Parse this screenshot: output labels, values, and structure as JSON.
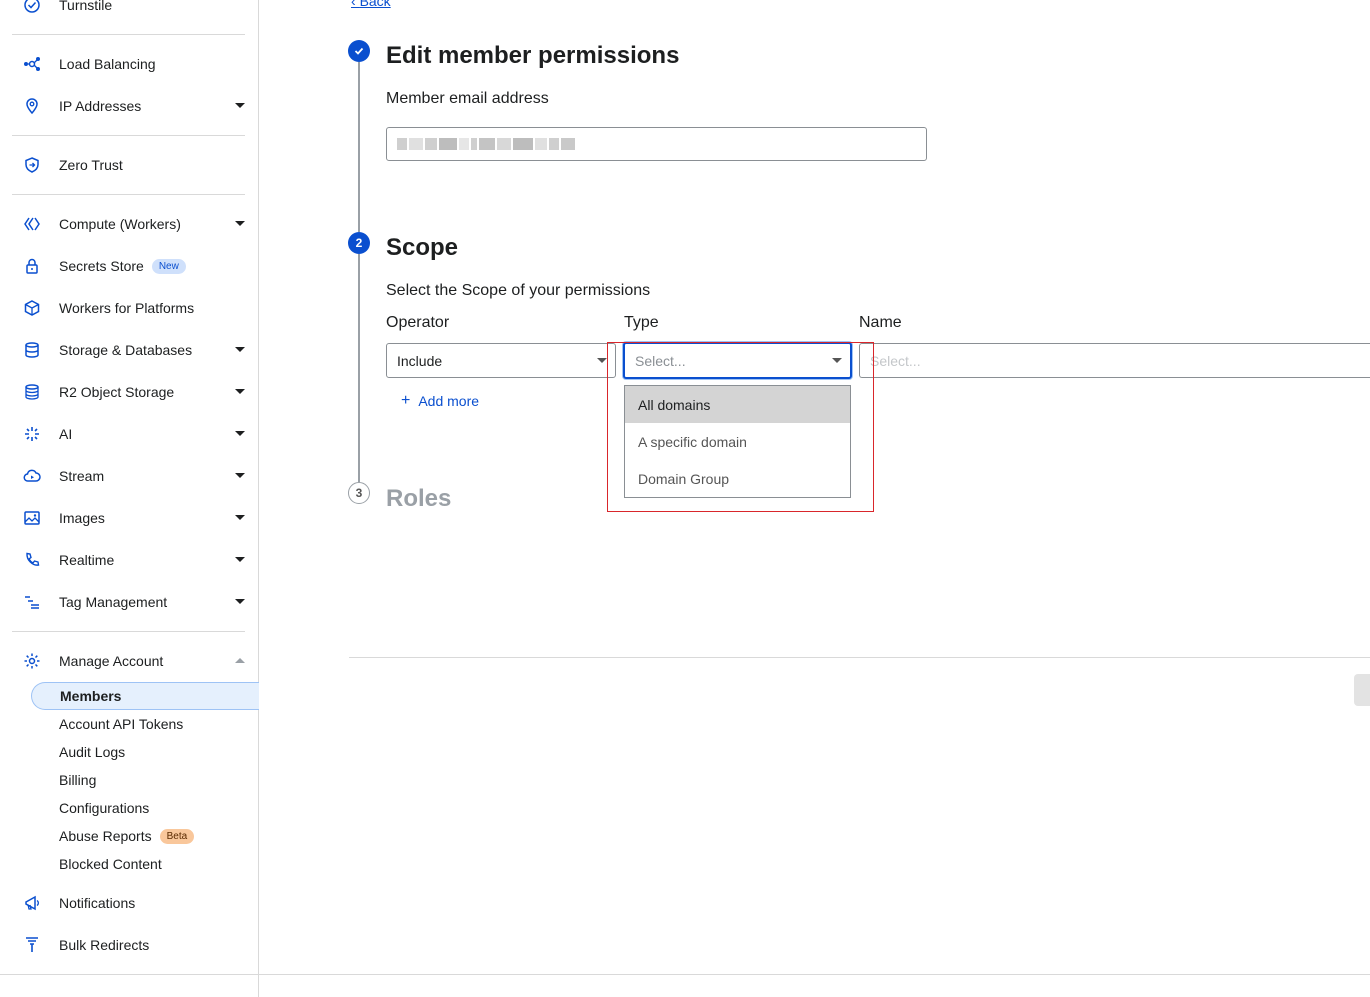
{
  "sidebar": {
    "turnstile": "Turnstile",
    "load_balancing": "Load Balancing",
    "ip_addresses": "IP Addresses",
    "zero_trust": "Zero Trust",
    "compute_workers": "Compute (Workers)",
    "secrets_store": "Secrets Store",
    "secrets_badge": "New",
    "workers_platforms": "Workers for Platforms",
    "storage_databases": "Storage & Databases",
    "r2_storage": "R2 Object Storage",
    "ai": "AI",
    "stream": "Stream",
    "images": "Images",
    "realtime": "Realtime",
    "tag_management": "Tag Management",
    "manage_account": "Manage Account",
    "sub": {
      "members": "Members",
      "api_tokens": "Account API Tokens",
      "audit_logs": "Audit Logs",
      "billing": "Billing",
      "configurations": "Configurations",
      "abuse_reports": "Abuse Reports",
      "abuse_badge": "Beta",
      "blocked_content": "Blocked Content"
    },
    "notifications": "Notifications",
    "bulk_redirects": "Bulk Redirects"
  },
  "main": {
    "back": "Back",
    "step1": {
      "title": "Edit member permissions",
      "email_label": "Member email address"
    },
    "step2": {
      "number": "2",
      "title": "Scope",
      "subtitle": "Select the Scope of your permissions",
      "operator_label": "Operator",
      "type_label": "Type",
      "name_label": "Name",
      "operator_value": "Include",
      "type_placeholder": "Select...",
      "name_placeholder": "Select...",
      "add_more": "Add more"
    },
    "step3": {
      "number": "3",
      "title": "Roles"
    },
    "type_options": [
      "All domains",
      "A specific domain",
      "Domain Group"
    ]
  },
  "colors": {
    "accent": "#0a4fcf",
    "highlight": "#d9262b"
  }
}
